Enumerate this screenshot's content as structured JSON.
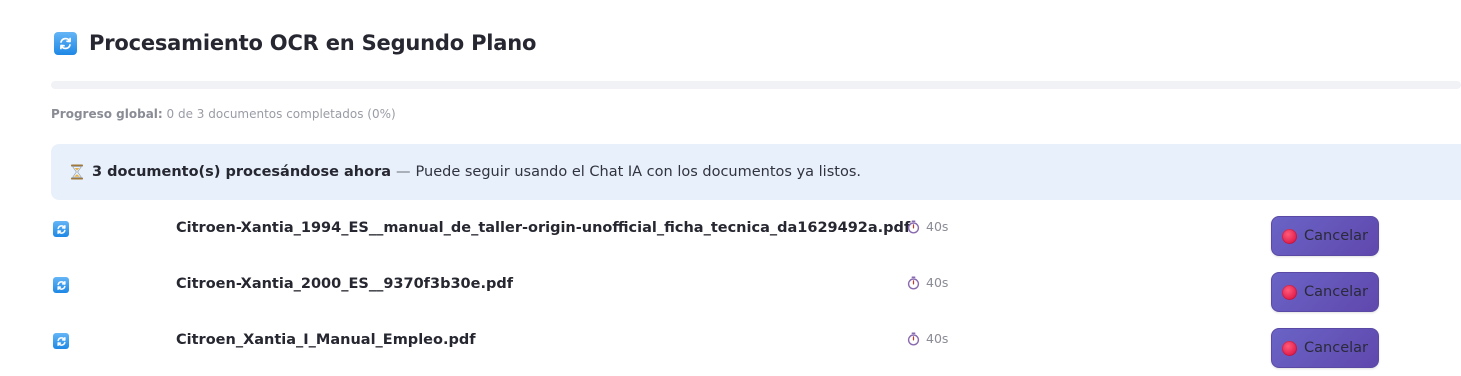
{
  "header": {
    "title": "Procesamiento OCR en Segundo Plano",
    "icon": "sync-icon"
  },
  "progress": {
    "label": "Progreso global:",
    "text": "0 de 3 documentos completados (0%)",
    "fraction": 0
  },
  "banner": {
    "icon": "hourglass-icon",
    "strong": "3 documento(s) procesándose ahora",
    "dash": "—",
    "text": "Puede seguir usando el Chat IA con los documentos ya listos."
  },
  "documents": [
    {
      "name": "Citroen-Xantia_1994_ES__manual_de_taller-origin-unofficial_ficha_tecnica_da1629492a.pdf",
      "elapsed": "40s",
      "cancel_label": "Cancelar"
    },
    {
      "name": "Citroen-Xantia_2000_ES__9370f3b30e.pdf",
      "elapsed": "40s",
      "cancel_label": "Cancelar"
    },
    {
      "name": "Citroen_Xantia_I_Manual_Empleo.pdf",
      "elapsed": "40s",
      "cancel_label": "Cancelar"
    }
  ],
  "colors": {
    "accent": "#1e88e5",
    "banner_bg": "#e8f1fb",
    "button_bg": "#6553b8",
    "cancel_dot": "#e01e4c"
  }
}
